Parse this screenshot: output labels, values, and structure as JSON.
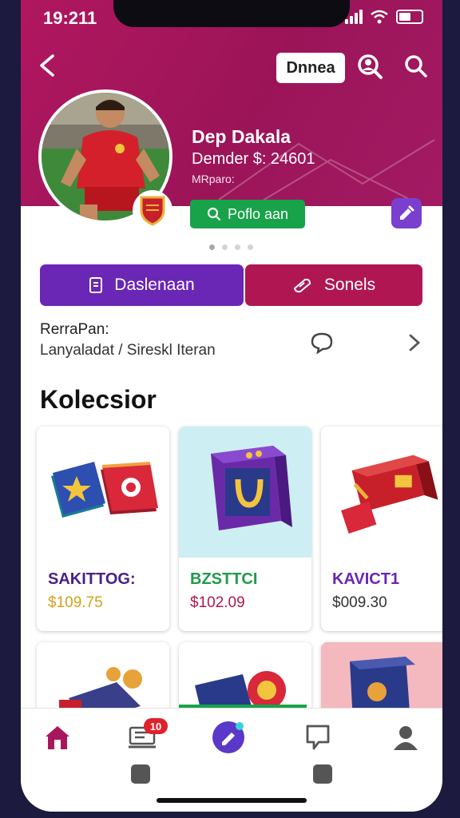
{
  "status_bar": {
    "time": "19:211"
  },
  "header": {
    "chip_label": "Dnnea",
    "profile_name": "Dep Dakala",
    "balance": "Demder $: 24601",
    "subtitle": "MRparo:",
    "follow_label": "Poflo aan"
  },
  "tabs": [
    {
      "label": "Daslenaan"
    },
    {
      "label": "Sonels"
    }
  ],
  "info": {
    "title": "RerraPan:",
    "text": "Lanyaladat / Sireskl Iteran"
  },
  "collection": {
    "title": "Kolecsior",
    "items": [
      {
        "name": "SAKITTOG:",
        "price": "$109.75",
        "name_color": "#4a1f8a",
        "price_color": "#d6a21a"
      },
      {
        "name": "BZSTTCI",
        "price": "$102.09",
        "name_color": "#1f9a4a",
        "price_color": "#b01752"
      },
      {
        "name": "KAVICT1",
        "price": "$009.30",
        "name_color": "#6a26b4",
        "price_color": "#333333"
      }
    ]
  },
  "bottom_nav": {
    "items": [
      "home-icon",
      "inbox-icon",
      "compose-icon",
      "chat-icon",
      "profile-icon"
    ],
    "badge": "10"
  },
  "colors": {
    "header_bg": "#a8175d",
    "tab_primary": "#6a26b4",
    "tab_secondary": "#b01752",
    "follow_green": "#18a34a"
  }
}
